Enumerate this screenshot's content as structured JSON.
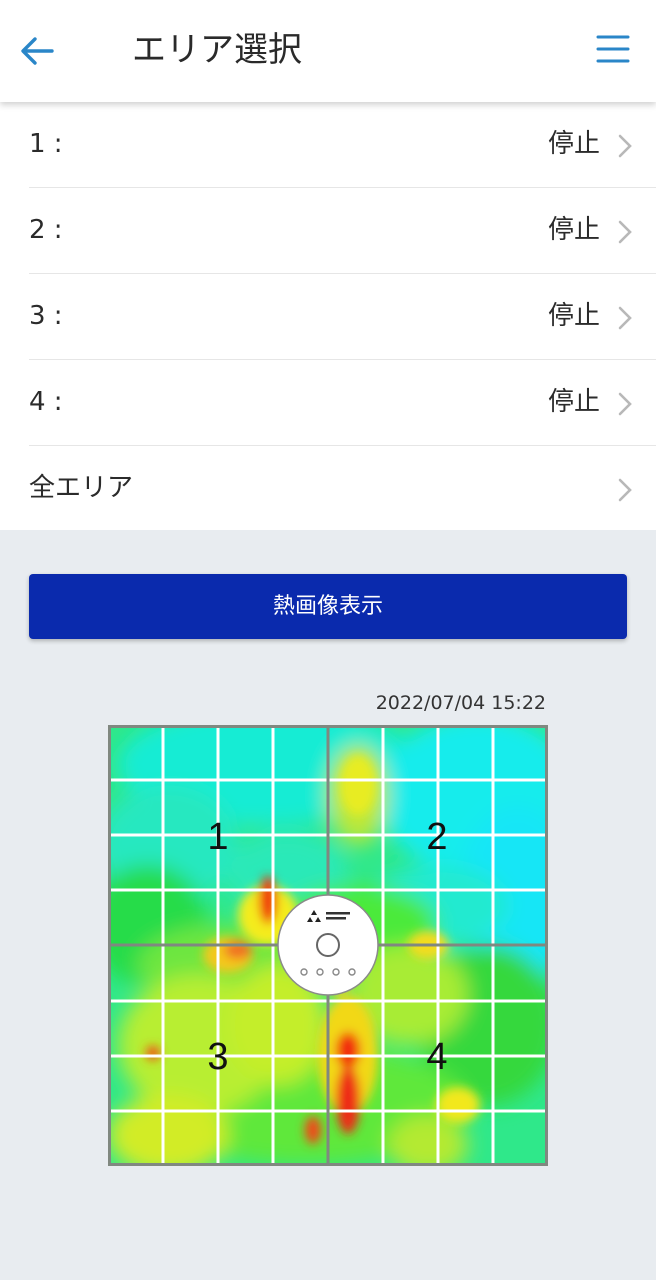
{
  "header": {
    "title": "エリア選択",
    "back_icon": "arrow-left-icon",
    "menu_icon": "hamburger-menu-icon"
  },
  "areas": [
    {
      "label": "1 :",
      "status": "停止"
    },
    {
      "label": "2 :",
      "status": "停止"
    },
    {
      "label": "3 :",
      "status": "停止"
    },
    {
      "label": "4 :",
      "status": "停止"
    },
    {
      "label": "全エリア",
      "status": ""
    }
  ],
  "thermal_button": {
    "label": "熱画像表示"
  },
  "thermal_map": {
    "timestamp": "2022/07/04 15:22",
    "zones": [
      "1",
      "2",
      "3",
      "4"
    ],
    "grid": "8x8",
    "center_device": "ceiling-unit-sensor"
  },
  "colors": {
    "accent": "#0a2aad",
    "icon_blue": "#2a86c8",
    "background": "#e8ecf0"
  }
}
